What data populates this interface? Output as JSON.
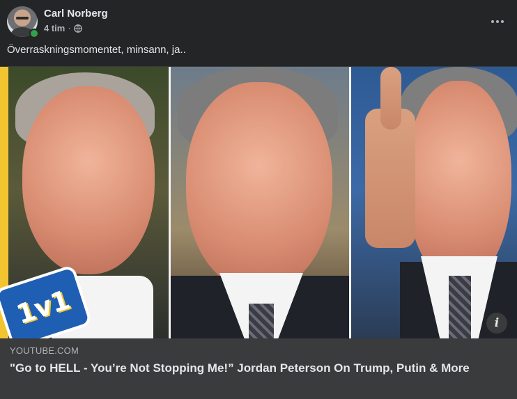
{
  "post": {
    "author": "Carl Norberg",
    "time": "4 tim",
    "separator": "·",
    "privacy_icon": "globe-icon",
    "text": "Överraskningsmomentet, minsann, ja.."
  },
  "media": {
    "badge_text": "1v1",
    "info_icon_text": "i"
  },
  "link_preview": {
    "domain": "YOUTUBE.COM",
    "title": "\"Go to HELL - You’re Not Stopping Me!” Jordan Peterson On Trump, Putin & More"
  },
  "colors": {
    "background": "#242526",
    "link_box": "#3a3b3c",
    "online": "#31a24c",
    "text_primary": "#e4e6eb",
    "text_secondary": "#b0b3b8"
  }
}
